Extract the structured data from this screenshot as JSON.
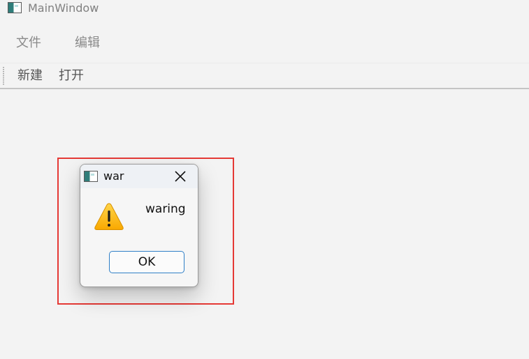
{
  "window": {
    "title": "MainWindow",
    "icon": "app-window-icon"
  },
  "menubar": {
    "items": [
      {
        "label": "文件"
      },
      {
        "label": "编辑"
      }
    ]
  },
  "toolbar": {
    "items": [
      {
        "label": "新建"
      },
      {
        "label": "打开"
      }
    ]
  },
  "dialog": {
    "title": "war",
    "icon": "app-window-icon",
    "close_icon": "close-icon",
    "message_icon": "warning-icon",
    "message": "waring",
    "ok_label": "OK"
  },
  "colors": {
    "highlight_border": "#e53935",
    "ok_button_border": "#2f7fc7",
    "warning_fill": "#ffc107"
  }
}
